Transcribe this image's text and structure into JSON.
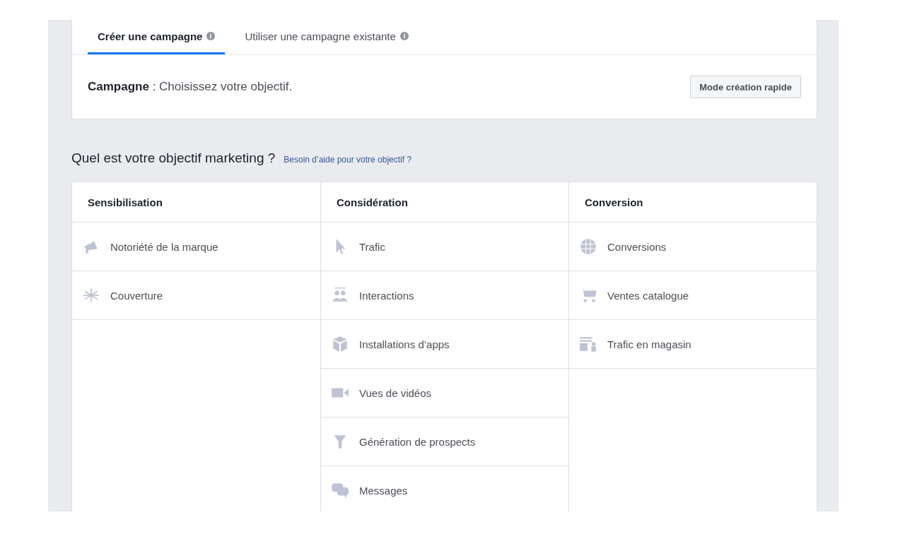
{
  "tabs": [
    {
      "label": "Créer une campagne",
      "selected": true
    },
    {
      "label": "Utiliser une campagne existante",
      "selected": false
    }
  ],
  "campaign": {
    "label": "Campagne",
    "text": " : Choisissez votre objectif.",
    "button": "Mode création rapide"
  },
  "objective": {
    "question": "Quel est votre objectif marketing ?",
    "help_link": "Besoin d’aide pour votre objectif ?"
  },
  "columns": [
    {
      "title": "Sensibilisation",
      "items": [
        "Notoriété de la marque",
        "Couverture"
      ]
    },
    {
      "title": "Considération",
      "items": [
        "Trafic",
        "Interactions",
        "Installations d’apps",
        "Vues de vidéos",
        "Génération de prospects",
        "Messages"
      ]
    },
    {
      "title": "Conversion",
      "items": [
        "Conversions",
        "Ventes catalogue",
        "Trafic en magasin"
      ]
    }
  ]
}
